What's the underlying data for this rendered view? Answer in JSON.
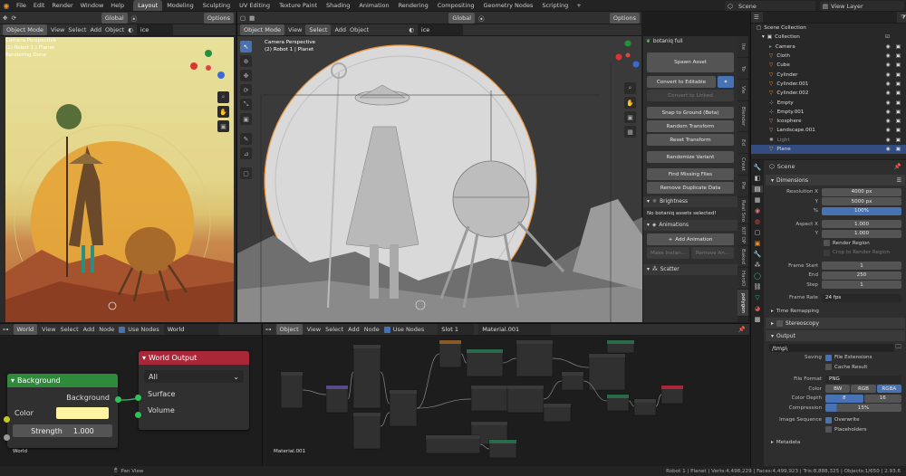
{
  "topbar": {
    "menus": [
      "File",
      "Edit",
      "Render",
      "Window",
      "Help"
    ],
    "workspaces": [
      "Layout",
      "Modeling",
      "Sculpting",
      "UV Editing",
      "Texture Paint",
      "Shading",
      "Animation",
      "Rendering",
      "Compositing",
      "Geometry Nodes",
      "Scripting"
    ],
    "active_workspace": "Layout",
    "scene": "Scene",
    "view_layer": "View Layer"
  },
  "left_viewport": {
    "transform": "Global",
    "options": "Options",
    "mode": "Object Mode",
    "menus": [
      "View",
      "Select",
      "Add",
      "Object"
    ],
    "search": "ice",
    "overlay_title": "Camera Perspective",
    "overlay_object": "(2) Robot 1 | Planet",
    "overlay_status": "Rendering Done"
  },
  "main_viewport": {
    "transform": "Global",
    "options": "Options",
    "mode": "Object Mode",
    "menus": [
      "View",
      "Select",
      "Add",
      "Object"
    ],
    "search": "ice",
    "overlay_title": "Camera Perspective",
    "overlay_object": "(2) Robot 1 | Planet"
  },
  "npanel": {
    "title": "botaniq full",
    "buttons": [
      "Spawn Asset",
      "Convert to Editable",
      "Convert to Linked",
      "Snap to Ground (Beta)",
      "Random Transform",
      "Reset Transform",
      "Randomize Variant",
      "Find Missing Files",
      "Remove Duplicate Data"
    ],
    "brightness_label": "Brightness",
    "brightness_msg": "No botaniq assets selected!",
    "animations_label": "Animations",
    "add_animation": "Add Animation",
    "make_instance": "Make Instan...",
    "remove_anim": "Remove An...",
    "scatter_label": "Scatter",
    "tabs": [
      "Ite",
      "To",
      "Vie",
      "Blender",
      "Ed",
      "Creat",
      "Pie",
      "Real Sno",
      "KIT OP",
      "Baked",
      "HardO",
      "polygon"
    ]
  },
  "outliner": {
    "root": "Scene Collection",
    "collection": "Collection",
    "items": [
      "Camera",
      "Cloth",
      "Cube",
      "Cylinder",
      "Cylinder.001",
      "Cylinder.002",
      "Empty",
      "Empty.001",
      "Icosphere",
      "Landscape.001",
      "Light",
      "Plane"
    ]
  },
  "properties": {
    "scene_name": "Scene",
    "dimensions_label": "Dimensions",
    "res_x_label": "Resolution X",
    "res_x": "4000 px",
    "res_y_label": "Y",
    "res_y": "5000 px",
    "pct_label": "%",
    "pct": "100%",
    "aspect_x_label": "Aspect X",
    "aspect_x": "1.000",
    "aspect_y_label": "Y",
    "aspect_y": "1.000",
    "render_region": "Render Region",
    "crop_region": "Crop to Render Region",
    "frame_start_label": "Frame Start",
    "frame_start": "1",
    "end_label": "End",
    "end": "250",
    "step_label": "Step",
    "step": "1",
    "frame_rate_label": "Frame Rate",
    "frame_rate": "24 fps",
    "time_remap": "Time Remapping",
    "stereo": "Stereoscopy",
    "output_label": "Output",
    "output_path": "/tmp\\",
    "saving_label": "Saving",
    "file_ext": "File Extensions",
    "cache_result": "Cache Result",
    "file_format_label": "File Format",
    "file_format": "PNG",
    "color_label": "Color",
    "color_opts": [
      "BW",
      "RGB",
      "RGBA"
    ],
    "depth_label": "Color Depth",
    "depth_opts": [
      "8",
      "16"
    ],
    "compression_label": "Compression",
    "compression": "15%",
    "img_seq_label": "Image Sequence",
    "overwrite": "Overwrite",
    "placeholders": "Placeholders",
    "metadata": "Metadata"
  },
  "world_editor": {
    "type": "World",
    "menus": [
      "View",
      "Select",
      "Add",
      "Node"
    ],
    "use_nodes": "Use Nodes",
    "world_name": "World",
    "bg_node_title": "Background",
    "bg_out": "Background",
    "bg_color": "Color",
    "bg_strength_label": "Strength",
    "bg_strength": "1.000",
    "wo_title": "World Output",
    "wo_target": "All",
    "wo_surface": "Surface",
    "wo_volume": "Volume",
    "footer": "World",
    "bg_color_hex": "#fff4a0"
  },
  "material_editor": {
    "type": "Object",
    "menus": [
      "View",
      "Select",
      "Add",
      "Node"
    ],
    "use_nodes": "Use Nodes",
    "slot": "Slot 1",
    "material": "Material.001",
    "footer": "Material.001"
  },
  "statusbar": {
    "left": "Pan View",
    "right": "Robot 1 | Planet | Verts:4,498,229 | Faces:4,499,923 | Tris:8,888,325 | Objects:1/650 | 2.93.6"
  }
}
